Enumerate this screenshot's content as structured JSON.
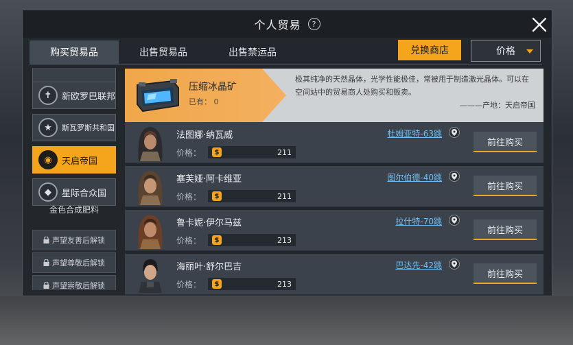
{
  "window": {
    "title": "个人贸易",
    "help": "?"
  },
  "tabs": [
    {
      "label": "购买贸易品",
      "active": true
    },
    {
      "label": "出售贸易品",
      "active": false
    },
    {
      "label": "出售禁运品",
      "active": false
    }
  ],
  "toolbar": {
    "exchange_label": "兑换商店",
    "sort_label": "价格"
  },
  "colors": {
    "accent": "#f4a51c",
    "link": "#6cc0f5"
  },
  "sidebar": {
    "factions": [
      {
        "name": "新欧罗巴联邦",
        "icon": "cross-emblem-icon",
        "active": false
      },
      {
        "name": "斯瓦罗斯共和国",
        "icon": "star-emblem-icon",
        "active": false
      },
      {
        "name": "天启帝国",
        "icon": "ring-emblem-icon",
        "active": true
      },
      {
        "name": "星际合众国",
        "icon": "shield-emblem-icon",
        "active": false
      }
    ],
    "caption": "金色合成肥料",
    "locked": [
      {
        "label": "声望友善后解锁"
      },
      {
        "label": "声望尊敬后解锁"
      },
      {
        "label": "声望崇敬后解锁"
      }
    ]
  },
  "item": {
    "name": "压缩冰晶矿",
    "owned": "已有： 0",
    "description": "极其纯净的天然晶体，光学性能极佳，常被用于制造激光晶体。可以在空间站中的贸易商人处购买和贩卖。",
    "origin": "———产地：天启帝国",
    "icon": "ice-crystal-container-icon"
  },
  "traders": [
    {
      "name": "法图娜·纳瓦威",
      "price_label": "价格：",
      "price": "211",
      "location": "杜姆亚特-63跳",
      "buy_label": "前往购买"
    },
    {
      "name": "塞芙娅·阿卡维亚",
      "price_label": "价格：",
      "price": "211",
      "location": "图尔伯德-40跳",
      "buy_label": "前往购买"
    },
    {
      "name": "鲁卡妮·伊尔马兹",
      "price_label": "价格：",
      "price": "213",
      "location": "拉什特-70跳",
      "buy_label": "前往购买"
    },
    {
      "name": "海丽叶·舒尔巴吉",
      "price_label": "价格：",
      "price": "213",
      "location": "巴达先-42跳",
      "buy_label": "前往购买"
    }
  ]
}
